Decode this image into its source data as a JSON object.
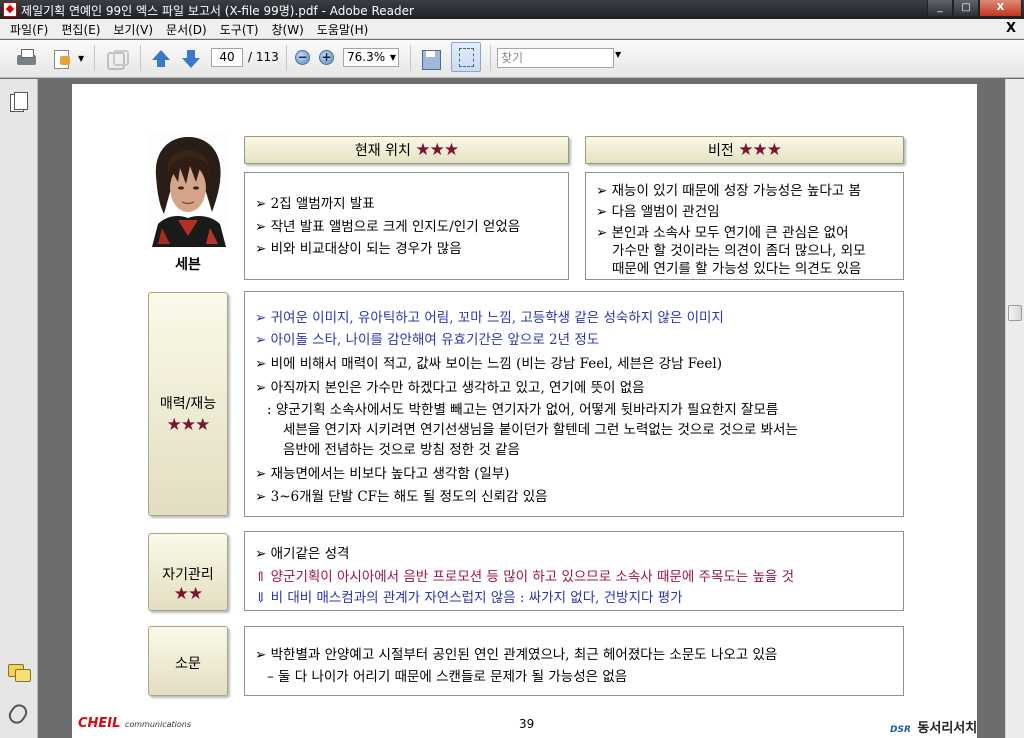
{
  "window": {
    "title": "제일기획 연예인 99인 엑스 파일 보고서 (X-file 99명).pdf - Adobe Reader",
    "buttons": {
      "minimize": "_",
      "maximize": "□",
      "close": "X"
    }
  },
  "menu": {
    "items": [
      "파일(F)",
      "편집(E)",
      "보기(V)",
      "문서(D)",
      "도구(T)",
      "창(W)",
      "도움말(H)"
    ],
    "doc_close": "X"
  },
  "toolbar": {
    "page_current": "40",
    "page_total": "/ 113",
    "zoom": "76.3%",
    "zoom_out": "−",
    "zoom_in": "+",
    "search_placeholder": "찾기"
  },
  "document": {
    "person_name": "세븐",
    "header_current": "현재 위치",
    "header_vision": "비전",
    "stars3": "★★★",
    "stars2": "★★",
    "current_lines": [
      "➢ 2집 앨범까지 발표",
      "➢ 작년 발표 앨범으로 크게 인지도/인기 얻었음",
      "➢ 비와 비교대상이 되는 경우가 많음"
    ],
    "vision_lines": [
      "➢ 재능이 있기 때문에 성장 가능성은 높다고 봄",
      "➢ 다음 앨범이 관건임",
      "➢ 본인과 소속사 모두 연기에 큰 관심은 없어",
      "가수만 할 것이라는 의견이 좀더 많으나, 외모",
      "때문에 연기를 할 가능성 있다는 의견도 있음"
    ],
    "charm_label": "매력/재능",
    "charm_lines": [
      "➢ 귀여운 이미지, 유아틱하고 어림, 꼬마 느낌, 고등학생 같은 성숙하지 않은 이미지",
      "➢ 아이돌 스타, 나이를 감안해여 유효기간은 앞으로 2년 정도",
      "➢ 비에 비해서 매력이 적고, 값싸 보이는 느낌 (비는 강남 Feel, 세븐은 강남 Feel)",
      "➢ 아직까지 본인은 가수만 하겠다고 생각하고 있고, 연기에 뜻이 없음",
      ": 양군기획 소속사에서도 박한별 빼고는 연기자가 없어, 어떻게 뒷바라지가 필요한지 잘모름",
      "세븐을 연기자 시키려면 연기선생님을 붙이던가 할텐데 그런 노력없는 것으로 것으로 봐서는",
      "음반에 전념하는 것으로 방침 정한 것 같음",
      "➢ 재능면에서는 비보다 높다고 생각함 (일부)",
      "➢ 3~6개월 단발 CF는 해도 될 정도의 신뢰감 있음"
    ],
    "self_label": "자기관리",
    "self_lines": [
      "➢ 애기같은 성격",
      "⇑ 양군기획이 아시아에서 음반 프로모션 등 많이 하고 있으므로 소속사 때문에 주목도는 높을 것",
      "⇓ 비 대비 매스컴과의 관계가 자연스럽지 않음 : 싸가지 없다, 건방지다 평가"
    ],
    "rumor_label": "소문",
    "rumor_lines": [
      "➢ 박한별과 안양예고 시절부터 공인된 연인 관계였으나, 최근 헤어졌다는 소문도 나오고 있음",
      "– 둘 다 나이가 어리기 때문에 스캔들로 문제가 될 가능성은 없음"
    ],
    "page_number": "39",
    "footer_logo": "CHEIL",
    "footer_logo_sub": "communications",
    "footer_right_mark": "DSR",
    "footer_right": "동서리서치"
  },
  "colors": {
    "star": "#7a1430",
    "blue_text": "#2b35a8",
    "red_text": "#9c1447"
  }
}
